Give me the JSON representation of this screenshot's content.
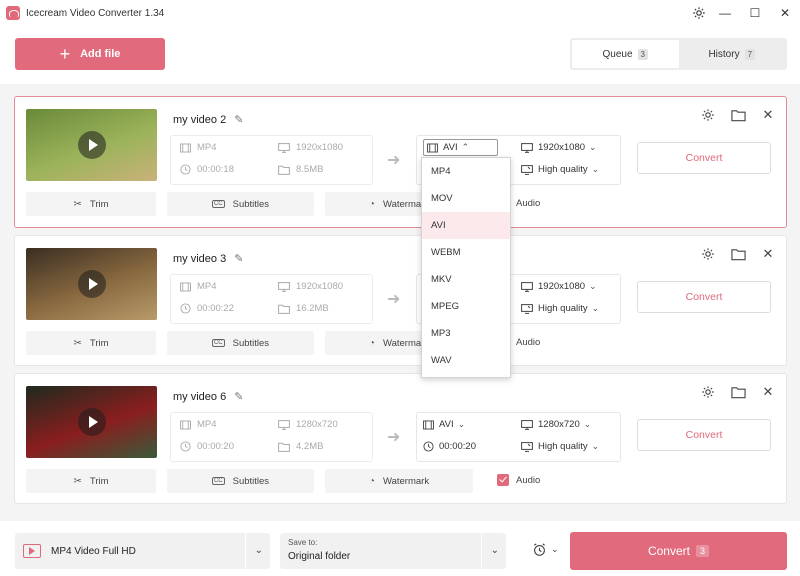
{
  "window": {
    "title": "Icecream Video Converter 1.34"
  },
  "header": {
    "add_file": "Add file",
    "tabs": [
      {
        "label": "Queue",
        "count": "3",
        "active": true
      },
      {
        "label": "History",
        "count": "7",
        "active": false
      }
    ]
  },
  "videos": [
    {
      "name": "my video 2",
      "source": {
        "format": "MP4",
        "resolution": "1920x1080",
        "duration": "00:00:18",
        "size": "8.5MB"
      },
      "output": {
        "format": "AVI",
        "resolution": "1920x1080",
        "quality": "High quality",
        "duration": ""
      },
      "convert_label": "Convert",
      "tools": {
        "trim": "Trim",
        "subtitles": "Subtitles",
        "watermark": "Watermark",
        "audio": "Audio"
      },
      "thumb_colors": [
        "#6a8a3a",
        "#9bb35a",
        "#c9b27a"
      ]
    },
    {
      "name": "my video 3",
      "source": {
        "format": "MP4",
        "resolution": "1920x1080",
        "duration": "00:00:22",
        "size": "16.2MB"
      },
      "output": {
        "format": "AVI",
        "resolution": "1920x1080",
        "quality": "High quality",
        "duration": ""
      },
      "convert_label": "Convert",
      "tools": {
        "trim": "Trim",
        "subtitles": "Subtitles",
        "watermark": "Watermark",
        "audio": "Audio"
      },
      "thumb_colors": [
        "#3a2e22",
        "#8a6a40",
        "#b89a6a"
      ]
    },
    {
      "name": "my video 6",
      "source": {
        "format": "MP4",
        "resolution": "1280x720",
        "duration": "00:00:20",
        "size": "4.2MB"
      },
      "output": {
        "format": "AVI",
        "resolution": "1280x720",
        "quality": "High quality",
        "duration": "00:00:20"
      },
      "convert_label": "Convert",
      "tools": {
        "trim": "Trim",
        "subtitles": "Subtitles",
        "watermark": "Watermark",
        "audio": "Audio"
      },
      "thumb_colors": [
        "#1e2a1e",
        "#8a1e1e",
        "#3a5a3a"
      ]
    }
  ],
  "format_dropdown": {
    "options": [
      "MP4",
      "MOV",
      "AVI",
      "WEBM",
      "MKV",
      "MPEG",
      "MP3",
      "WAV"
    ],
    "selected": "AVI"
  },
  "footer": {
    "preset": "MP4 Video Full HD",
    "save_to_caption": "Save to:",
    "save_to_value": "Original folder",
    "convert_label": "Convert",
    "convert_count": "3"
  },
  "colors": {
    "accent": "#e16b7c",
    "selected_border": "#e38b97",
    "dropdown_selected": "#fbe9ec"
  }
}
